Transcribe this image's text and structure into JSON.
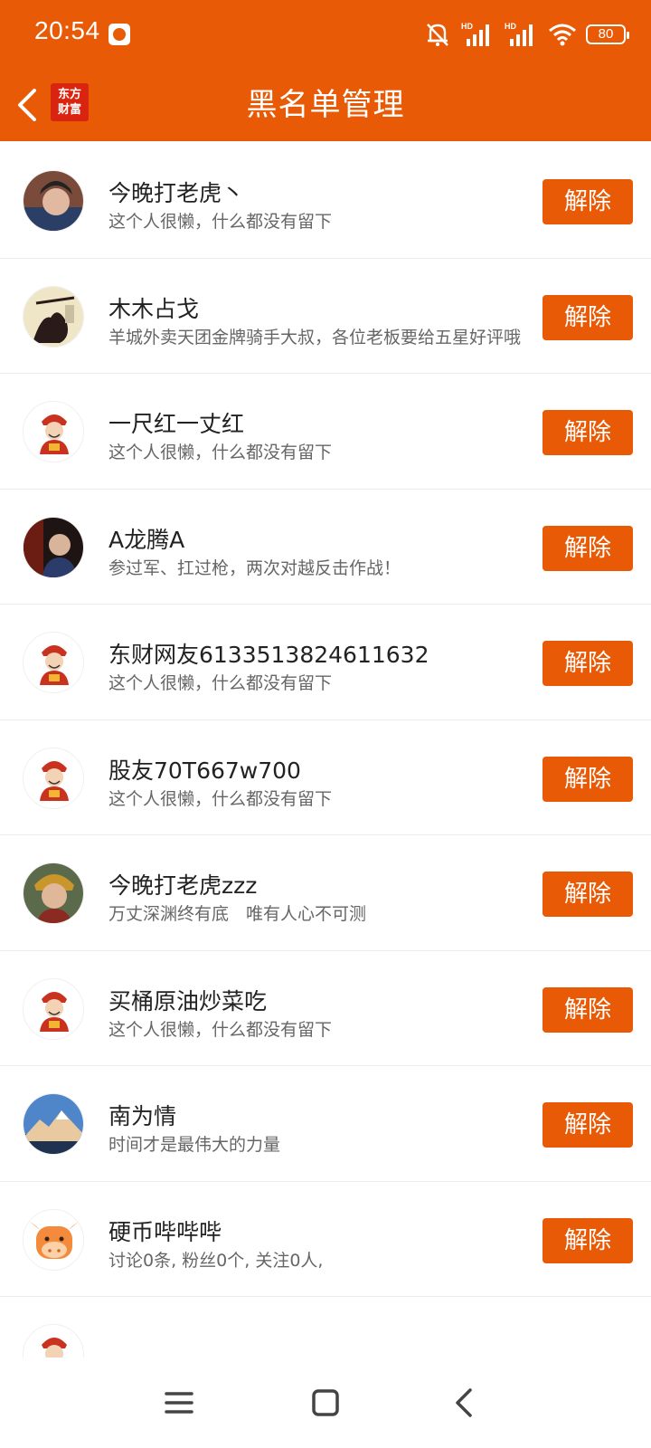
{
  "status": {
    "time": "20:54",
    "battery": "80",
    "signal_labels": [
      "HD",
      "HD"
    ]
  },
  "nav": {
    "title": "黑名单管理",
    "logo_line1": "东方",
    "logo_line2": "财富"
  },
  "colors": {
    "accent": "#e85a06",
    "name_text": "#222222",
    "desc_text": "#666666"
  },
  "rows": [
    {
      "name": "今晚打老虎丶",
      "desc": "这个人很懒，什么都没有留下",
      "button": "解除",
      "avatar": "photo-person-icon"
    },
    {
      "name": "木木占戈",
      "desc": "羊城外卖天团金牌骑手大叔，各位老板要给五星好评哦",
      "button": "解除",
      "avatar": "photo-ink-icon"
    },
    {
      "name": "一尺红一丈红",
      "desc": "这个人很懒，什么都没有留下",
      "button": "解除",
      "avatar": "fortune-god-icon"
    },
    {
      "name": "A龙腾A",
      "desc": "参过军、扛过枪，两次对越反击作战！",
      "button": "解除",
      "avatar": "photo-dark-icon"
    },
    {
      "name": "东财网友6133513824611632",
      "desc": "这个人很懒，什么都没有留下",
      "button": "解除",
      "avatar": "fortune-god-icon"
    },
    {
      "name": "股友70T667w700",
      "desc": "这个人很懒，什么都没有留下",
      "button": "解除",
      "avatar": "fortune-god-icon"
    },
    {
      "name": "今晚打老虎zzz",
      "desc": "万丈深渊终有底　唯有人心不可测",
      "button": "解除",
      "avatar": "photo-person-icon"
    },
    {
      "name": "买桶原油炒菜吃",
      "desc": "这个人很懒，什么都没有留下",
      "button": "解除",
      "avatar": "fortune-god-icon"
    },
    {
      "name": "南为情",
      "desc": "时间才是最伟大的力量",
      "button": "解除",
      "avatar": "photo-mountain-icon"
    },
    {
      "name": "硬币哔哔哔",
      "desc": "讨论0条, 粉丝0个, 关注0人,",
      "button": "解除",
      "avatar": "cow-icon"
    },
    {
      "name": "",
      "desc": "",
      "button": "",
      "avatar": "fortune-god-icon"
    }
  ]
}
